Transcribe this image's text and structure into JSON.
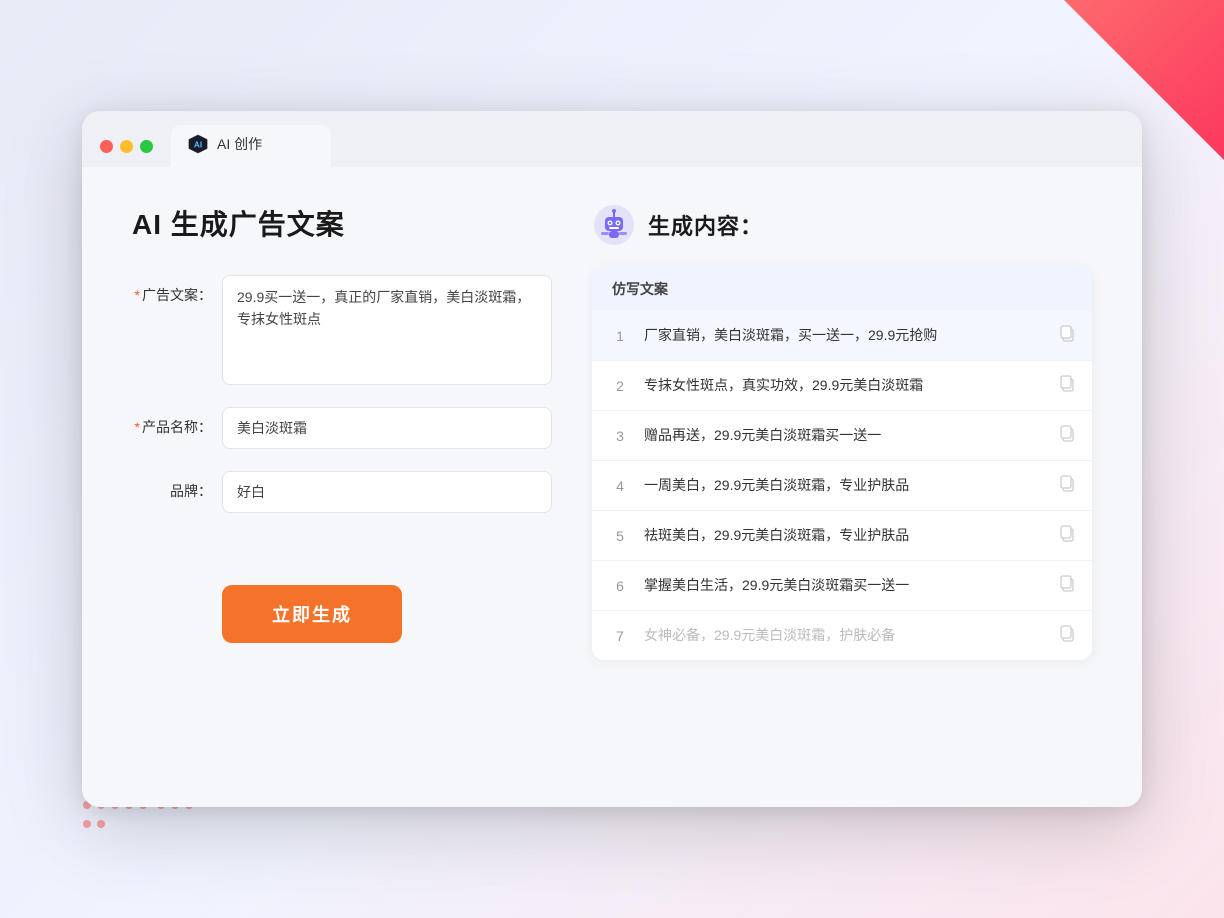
{
  "browser": {
    "tab_label": "AI 创作"
  },
  "page": {
    "title": "AI 生成广告文案",
    "form": {
      "ad_copy_label": "广告文案：",
      "ad_copy_required": "*",
      "ad_copy_value": "29.9买一送一，真正的厂家直销，美白淡斑霜，专抹女性斑点",
      "product_name_label": "产品名称：",
      "product_name_required": "*",
      "product_name_value": "美白淡斑霜",
      "brand_label": "品牌：",
      "brand_value": "好白",
      "generate_btn": "立即生成"
    },
    "result": {
      "header": "生成内容：",
      "column_header": "仿写文案",
      "items": [
        {
          "num": "1",
          "text": "厂家直销，美白淡斑霜，买一送一，29.9元抢购",
          "muted": false
        },
        {
          "num": "2",
          "text": "专抹女性斑点，真实功效，29.9元美白淡斑霜",
          "muted": false
        },
        {
          "num": "3",
          "text": "赠品再送，29.9元美白淡斑霜买一送一",
          "muted": false
        },
        {
          "num": "4",
          "text": "一周美白，29.9元美白淡斑霜，专业护肤品",
          "muted": false
        },
        {
          "num": "5",
          "text": "祛斑美白，29.9元美白淡斑霜，专业护肤品",
          "muted": false
        },
        {
          "num": "6",
          "text": "掌握美白生活，29.9元美白淡斑霜买一送一",
          "muted": false
        },
        {
          "num": "7",
          "text": "女神必备，29.9元美白淡斑霜，护肤必备",
          "muted": true
        }
      ]
    }
  }
}
